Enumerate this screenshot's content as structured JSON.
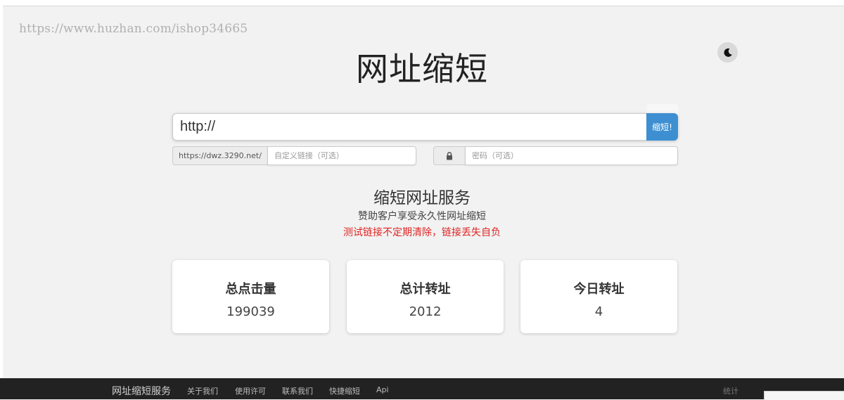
{
  "watermark": "https://www.huzhan.com/ishop34665",
  "icons": {
    "theme_toggle": "moon-icon",
    "password": "lock-icon"
  },
  "colors": {
    "accent": "#3d8fd1",
    "warning": "#e02424",
    "footer_bg": "#222222"
  },
  "header": {
    "title": "网址缩短"
  },
  "shorten_form": {
    "url_value": "http://",
    "submit_label": "缩短!",
    "prefix": "https://dwz.3290.net/",
    "custom_placeholder": "自定义链接（可选）",
    "password_placeholder": "密码（可选）"
  },
  "service": {
    "title": "缩短网址服务",
    "subtitle": "赞助客户享受永久性网址缩短",
    "warning": "测试链接不定期清除，链接丢失自负"
  },
  "stats": [
    {
      "label": "总点击量",
      "value": "199039"
    },
    {
      "label": "总计转址",
      "value": "2012"
    },
    {
      "label": "今日转址",
      "value": "4"
    }
  ],
  "footer": {
    "brand": "网址缩短服务",
    "links": [
      "关于我们",
      "使用许可",
      "联系我们",
      "快捷缩短",
      "Api"
    ],
    "stats_link": "统计"
  }
}
